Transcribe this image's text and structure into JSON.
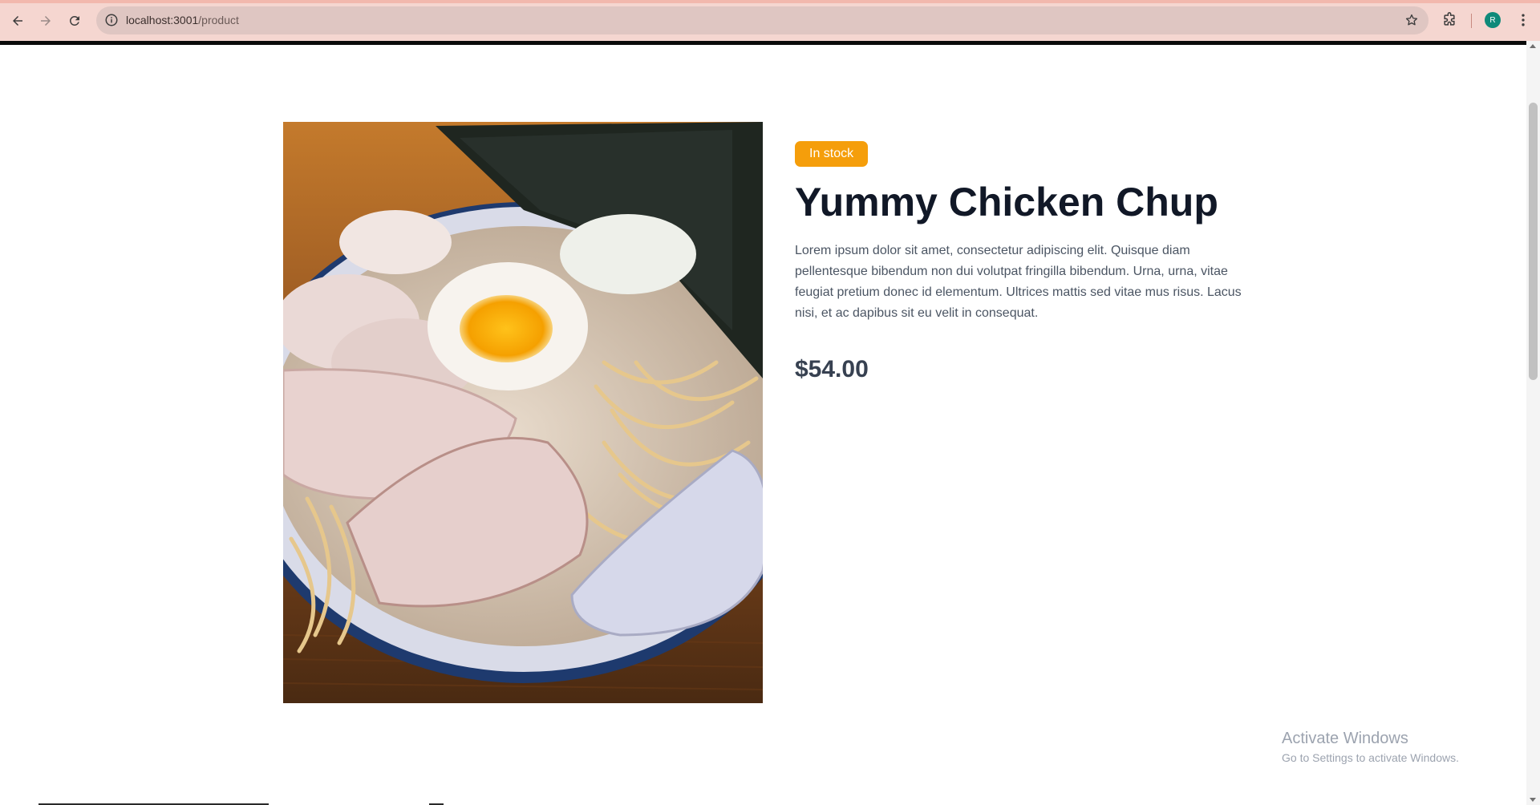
{
  "browser": {
    "url_host": "localhost:3001",
    "url_path": "/product",
    "avatar_initial": "R",
    "icons": {
      "back": "arrow-left-icon",
      "forward": "arrow-right-icon",
      "reload": "reload-icon",
      "site_info": "info-circle-icon",
      "bookmark": "star-icon",
      "extensions": "puzzle-icon",
      "menu": "kebab-menu-icon"
    }
  },
  "product": {
    "stock_label": "In stock",
    "title": "Yummy Chicken Chup",
    "description": "Lorem ipsum dolor sit amet, consectetur adipiscing elit. Quisque diam pellentesque bibendum non dui volutpat fringilla bibendum. Urna, urna, vitae feugiat pretium donec id elementum. Ultrices mattis sed vitae mus risus. Lacus nisi, et ac dapibus sit eu velit in consequat.",
    "price": "$54.00",
    "image_label": "ramen bowl photo"
  },
  "watermark": {
    "title": "Activate Windows",
    "subtitle": "Go to Settings to activate Windows."
  },
  "colors": {
    "badge": "#f59e0b",
    "title": "#111827",
    "price": "#374151",
    "chrome_bg": "#f5d6d0"
  }
}
